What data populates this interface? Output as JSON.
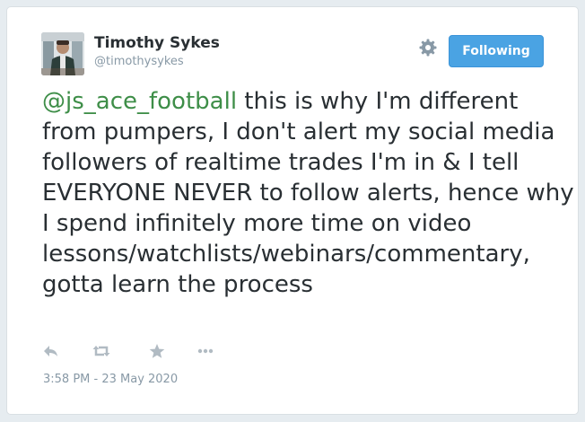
{
  "tweet": {
    "author": {
      "name": "Timothy Sykes",
      "handle": "@timothysykes"
    },
    "follow_label": "Following",
    "mention": "@js_ace_football",
    "body": " this is why I'm different from pumpers, I don't alert my social media followers of realtime trades I'm in & I tell EVERYONE NEVER to follow alerts, hence why I spend infinitely more time on video lessons/watchlists/webinars/commentary, gotta learn the process",
    "timestamp": "3:58 PM - 23 May 2020"
  },
  "icons": {
    "settings": "gear-icon",
    "reply": "reply-icon",
    "retweet": "retweet-icon",
    "favorite": "star-icon",
    "more": "more-icon"
  },
  "colors": {
    "mention": "#3e8e48",
    "follow_button": "#4aa3e3",
    "text": "#292f33",
    "muted": "#8899a6",
    "icon": "#b1bbc3"
  }
}
